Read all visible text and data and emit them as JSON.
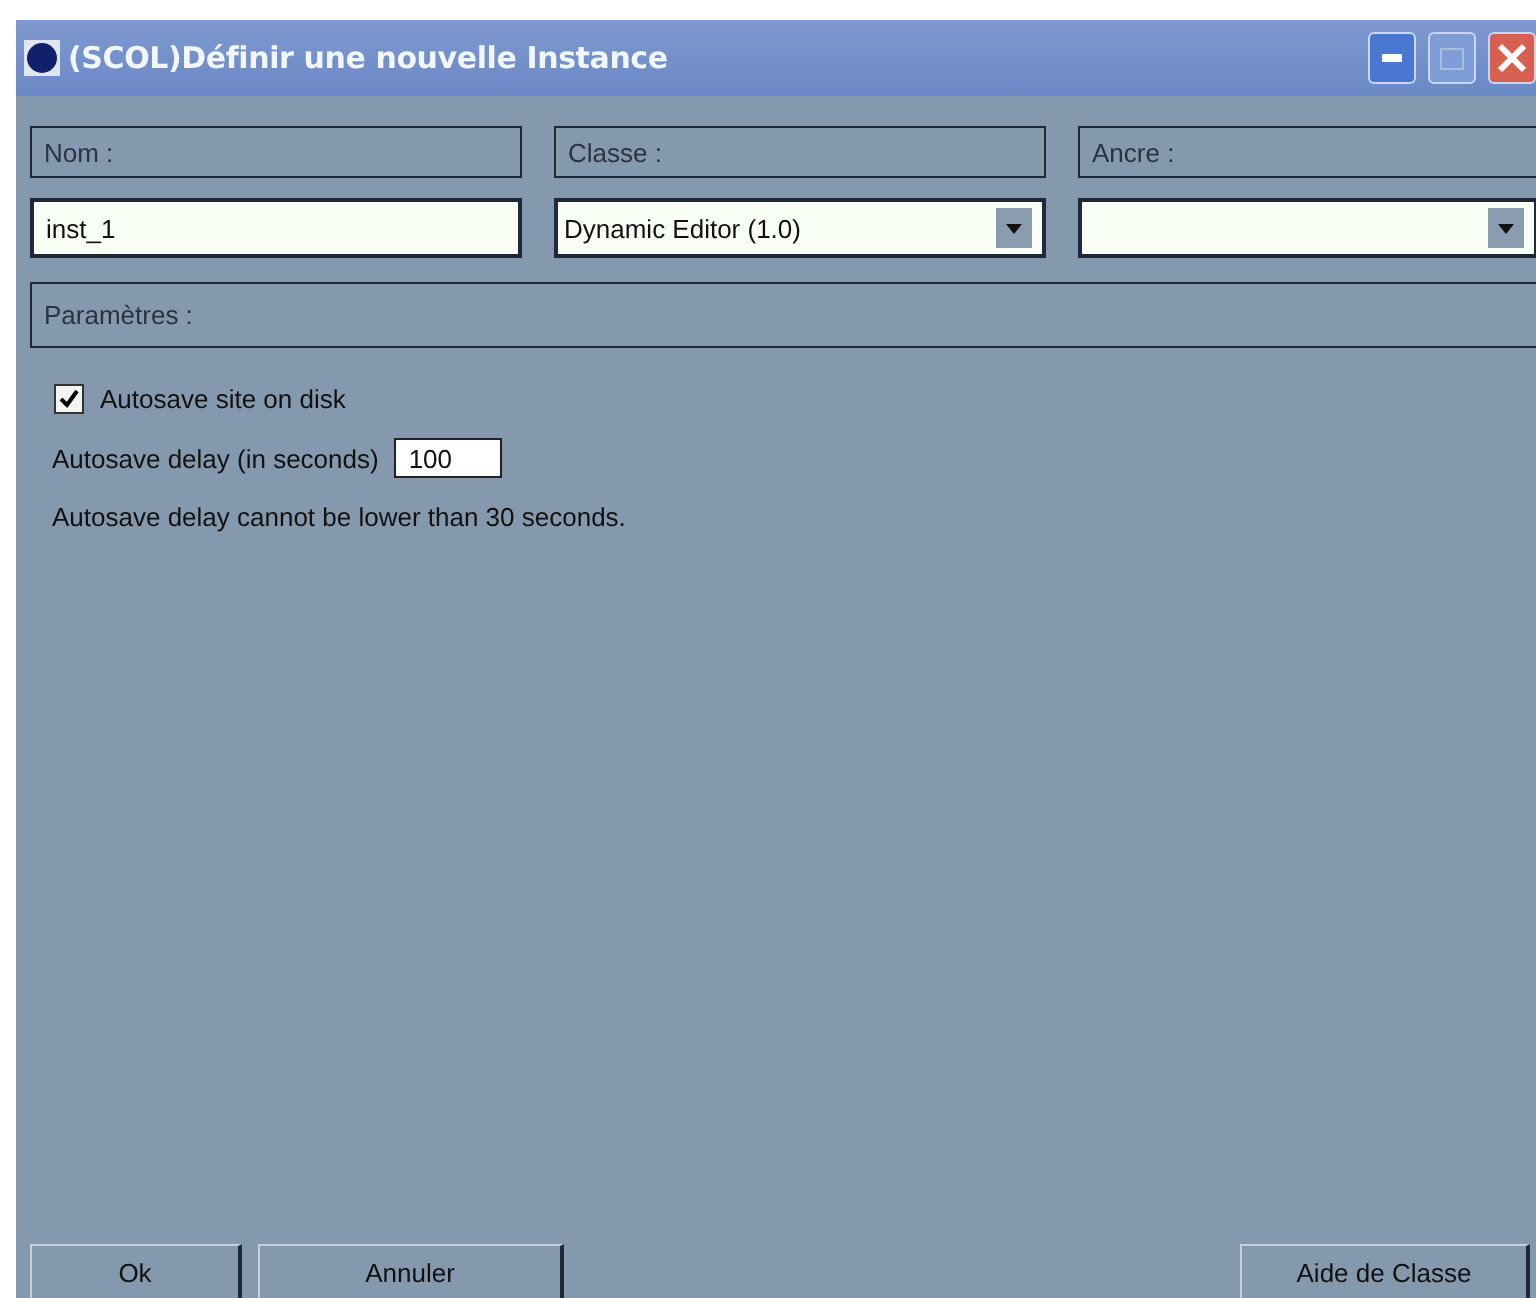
{
  "window": {
    "title": "(SCOL)Définir une nouvelle Instance"
  },
  "fields": [
    {
      "label": "Nom :",
      "kind": "text",
      "value": "inst_1"
    },
    {
      "label": "Classe :",
      "kind": "dropdown",
      "value": "Dynamic Editor (1.0)"
    },
    {
      "label": "Ancre :",
      "kind": "dropdown"
    }
  ],
  "parameters": {
    "heading": "Paramètres :",
    "autosave": {
      "label": "Autosave site on disk",
      "checked": true
    },
    "delay": {
      "label": "Autosave delay (in seconds)",
      "value": "100"
    },
    "note": "Autosave delay cannot be lower than 30 seconds."
  },
  "buttons_left": [
    "Ok",
    "Annuler"
  ],
  "buttons_right": [
    "Aide de Classe"
  ]
}
